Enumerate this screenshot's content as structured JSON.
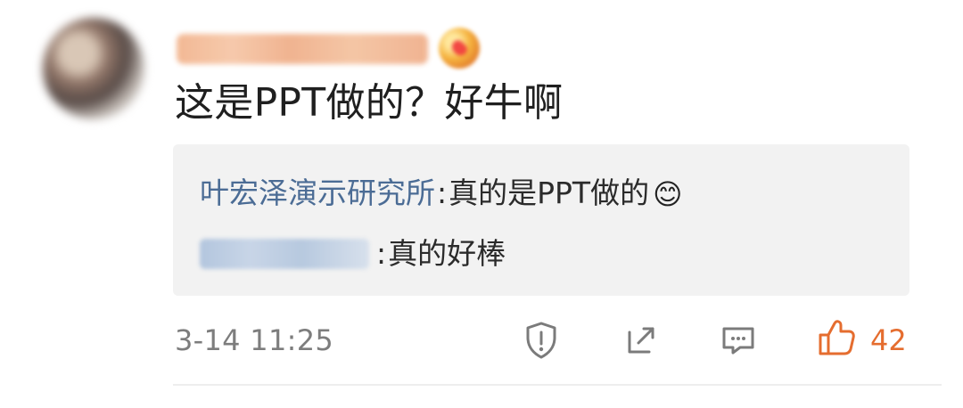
{
  "comment": {
    "text": "这是PPT做的？好牛啊"
  },
  "reply_box": {
    "line1": {
      "author": "叶宏泽演示研究所",
      "separator": ":",
      "text": "真的是PPT做的",
      "emoji": "😊"
    },
    "line2": {
      "separator": ":",
      "text": "真的好棒"
    }
  },
  "footer": {
    "timestamp": "3-14 11:25",
    "like_count": "42"
  },
  "icons": {
    "report": "shield-icon",
    "share": "share-icon",
    "comment": "comment-icon",
    "like": "thumbs-up-icon"
  },
  "colors": {
    "link_blue": "#4b6c95",
    "accent_orange": "#e56d2f",
    "muted_gray": "#7d7d7d",
    "reply_bg": "#f2f2f2"
  }
}
